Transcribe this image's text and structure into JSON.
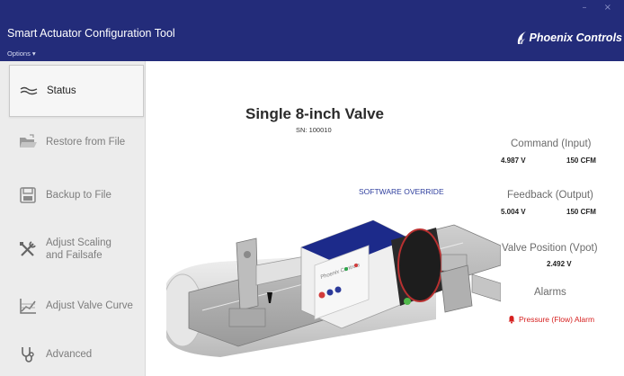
{
  "window": {
    "title": "Smart Actuator Configuration Tool",
    "options_menu": "Options ▾",
    "controls": "–  ×",
    "brand": "Phoenix Controls",
    "brand_icon": "phoenix-logo-icon"
  },
  "sidebar": {
    "items": [
      {
        "label": "Status",
        "icon": "status-icon",
        "active": true
      },
      {
        "label": "Restore from File",
        "icon": "folder-open-icon",
        "active": false
      },
      {
        "label": "Backup to File",
        "icon": "save-icon",
        "active": false
      },
      {
        "label": "Adjust Scaling\nand Failsafe",
        "icon": "tools-icon",
        "active": false
      },
      {
        "label": "Adjust Valve Curve",
        "icon": "curve-chart-icon",
        "active": false
      },
      {
        "label": "Advanced",
        "icon": "stethoscope-icon",
        "active": false
      }
    ]
  },
  "main": {
    "valve_title": "Single 8-inch Valve",
    "serial": "SN: 100010",
    "override": "SOFTWARE OVERRIDE",
    "image_icon": "valve-actuator-illustration"
  },
  "status": {
    "command": {
      "label": "Command (Input)",
      "voltage": "4.987 V",
      "flow": "150 CFM"
    },
    "feedback": {
      "label": "Feedback (Output)",
      "voltage": "5.004 V",
      "flow": "150 CFM"
    },
    "position": {
      "label": "Valve Position (Vpot)",
      "voltage": "2.492 V"
    },
    "alarms": {
      "label": "Alarms",
      "item": "Pressure (Flow) Alarm",
      "icon": "bell-icon",
      "color": "#d6201f"
    }
  },
  "colors": {
    "header": "#232c7a",
    "sidebar": "#ececec",
    "accent_link": "#2f3f9e",
    "alarm": "#d6201f"
  }
}
